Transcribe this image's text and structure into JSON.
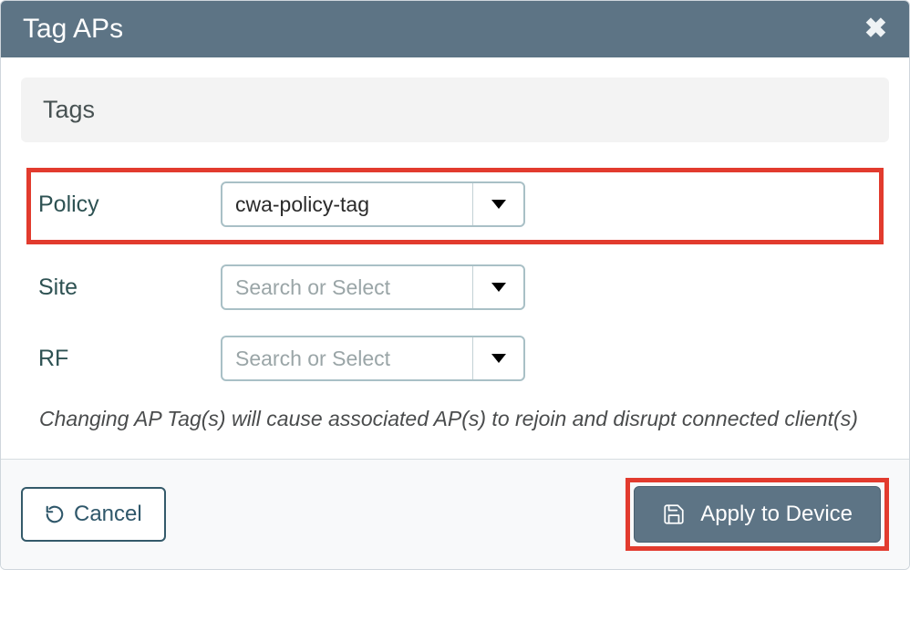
{
  "modal": {
    "title": "Tag APs",
    "close_icon": "close-icon"
  },
  "section": {
    "title": "Tags"
  },
  "fields": {
    "policy": {
      "label": "Policy",
      "value": "cwa-policy-tag",
      "placeholder": "Search or Select"
    },
    "site": {
      "label": "Site",
      "value": "",
      "placeholder": "Search or Select"
    },
    "rf": {
      "label": "RF",
      "value": "",
      "placeholder": "Search or Select"
    }
  },
  "warning": "Changing AP Tag(s) will cause associated AP(s) to rejoin and disrupt connected client(s)",
  "footer": {
    "cancel": "Cancel",
    "apply": "Apply to Device"
  },
  "colors": {
    "header_bg": "#5d7485",
    "highlight": "#e23b2e",
    "border": "#a9c0c6"
  }
}
